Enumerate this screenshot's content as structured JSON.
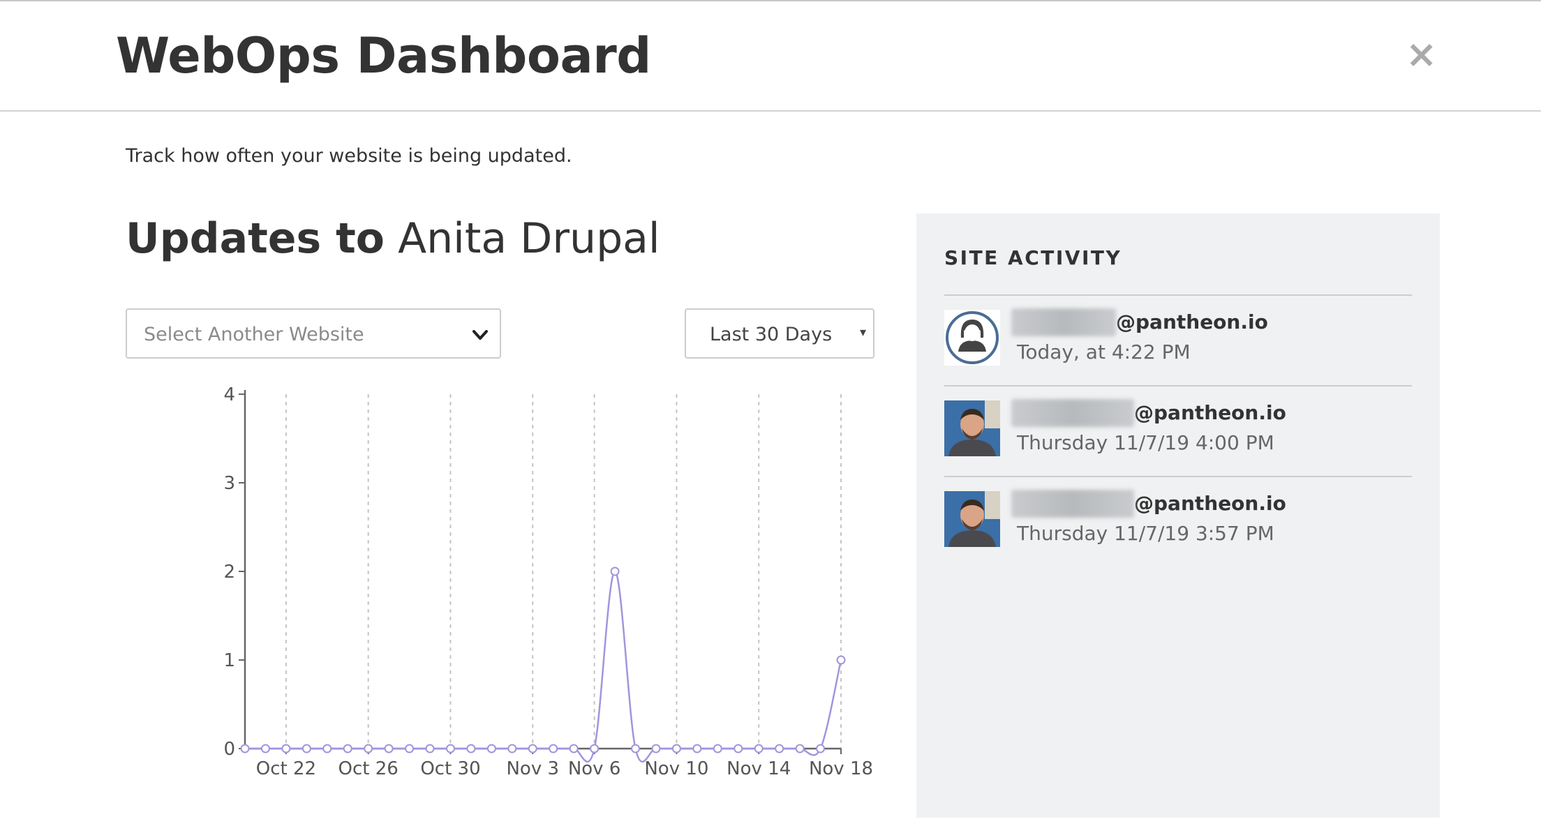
{
  "modal": {
    "title": "WebOps Dashboard",
    "close_glyph": "×",
    "close_icon": "close-icon"
  },
  "intro_text": "Track how often your website is being updated.",
  "heading": {
    "prefix": "Updates to",
    "site_name": "Anita Drupal"
  },
  "site_select": {
    "placeholder": "Select Another Website",
    "icon": "chevron-down-icon"
  },
  "range_select": {
    "selected": "Last 30 Days",
    "caret": "▾"
  },
  "chart_data": {
    "type": "line",
    "title": "",
    "xlabel": "",
    "ylabel": "",
    "ylim": [
      0,
      4
    ],
    "y_ticks": [
      0,
      1,
      2,
      3,
      4
    ],
    "x": [
      "Oct 20",
      "Oct 21",
      "Oct 22",
      "Oct 23",
      "Oct 24",
      "Oct 25",
      "Oct 26",
      "Oct 27",
      "Oct 28",
      "Oct 29",
      "Oct 30",
      "Oct 31",
      "Nov 1",
      "Nov 2",
      "Nov 3",
      "Nov 4",
      "Nov 5",
      "Nov 6",
      "Nov 7",
      "Nov 8",
      "Nov 9",
      "Nov 10",
      "Nov 11",
      "Nov 12",
      "Nov 13",
      "Nov 14",
      "Nov 15",
      "Nov 16",
      "Nov 17",
      "Nov 18"
    ],
    "x_tick_labels": [
      "Oct 22",
      "Oct 26",
      "Oct 30",
      "Nov 3",
      "Nov 6",
      "Nov 10",
      "Nov 14",
      "Nov 18"
    ],
    "series": [
      {
        "values": [
          0,
          0,
          0,
          0,
          0,
          0,
          0,
          0,
          0,
          0,
          0,
          0,
          0,
          0,
          0,
          0,
          0,
          0,
          2,
          0,
          0,
          0,
          0,
          0,
          0,
          0,
          0,
          0,
          0,
          1
        ]
      }
    ],
    "grid": "vertical dashed at x tick labels",
    "line_color": "#9f96dd",
    "axis_color": "#666666"
  },
  "activity": {
    "title": "SITE ACTIVITY",
    "items": [
      {
        "user_domain": "@pantheon.io",
        "time": "Today, at 4:22 PM",
        "avatar_icon": "default-avatar-icon"
      },
      {
        "user_domain": "@pantheon.io",
        "time": "Thursday 11/7/19 4:00 PM",
        "avatar_icon": "user-photo-icon"
      },
      {
        "user_domain": "@pantheon.io",
        "time": "Thursday 11/7/19 3:57 PM",
        "avatar_icon": "user-photo-icon"
      }
    ]
  }
}
